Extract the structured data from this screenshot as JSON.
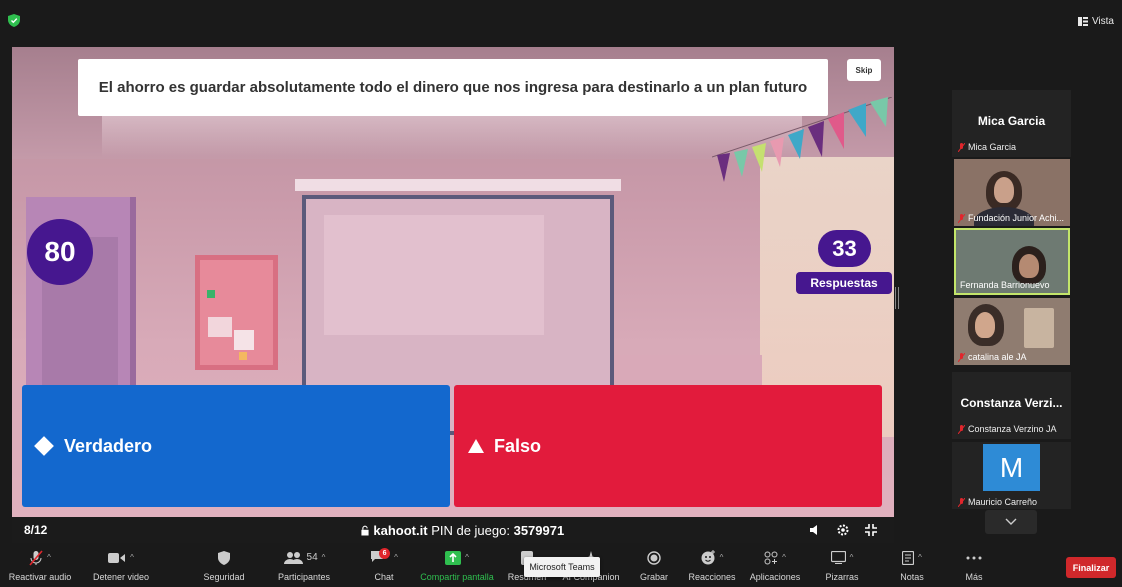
{
  "topbar": {
    "view_label": "Vista"
  },
  "share": {
    "question": "El ahorro es guardar absolutamente todo el dinero que nos ingresa para destinarlo a un plan futuro",
    "skip_label": "Skip",
    "timer": "80",
    "answers_count": "33",
    "answers_label": "Respuestas",
    "options": [
      {
        "label": "Verdadero",
        "shape": "diamond",
        "color": "#1368ce"
      },
      {
        "label": "Falso",
        "shape": "triangle",
        "color": "#e21b3c"
      }
    ],
    "progress": "8/12",
    "site": "kahoot.it",
    "pin_label": "PIN de juego:",
    "pin": "3579971"
  },
  "gallery": {
    "tiles": [
      {
        "big_name": "Mica Garcia",
        "name": "Mica Garcia",
        "video": false,
        "muted": true
      },
      {
        "name": "Fundación Junior Achi...",
        "video": true,
        "muted": true
      },
      {
        "name": "Fernanda Barrionuevo",
        "video": true,
        "muted": false,
        "active": true
      },
      {
        "name": "catalina ale JA",
        "video": true,
        "muted": true
      },
      {
        "big_name": "Constanza Verzi...",
        "name": "Constanza Verzino JA",
        "video": false,
        "muted": true
      },
      {
        "avatar_letter": "M",
        "name": "Mauricio Carreño",
        "video": false,
        "muted": true
      }
    ]
  },
  "toolbar": {
    "unmute": "Reactivar audio",
    "stop_video": "Detener video",
    "security": "Seguridad",
    "participants": "Participantes",
    "participants_count": "54",
    "chat": "Chat",
    "chat_badge": "6",
    "share_screen": "Compartir pantalla",
    "summary": "Resumen",
    "ai_companion": "AI Companion",
    "record": "Grabar",
    "reactions": "Reacciones",
    "apps": "Aplicaciones",
    "whiteboards": "Pizarras",
    "notes": "Notas",
    "more": "Más",
    "end": "Finalizar",
    "tooltip": "Microsoft Teams"
  }
}
